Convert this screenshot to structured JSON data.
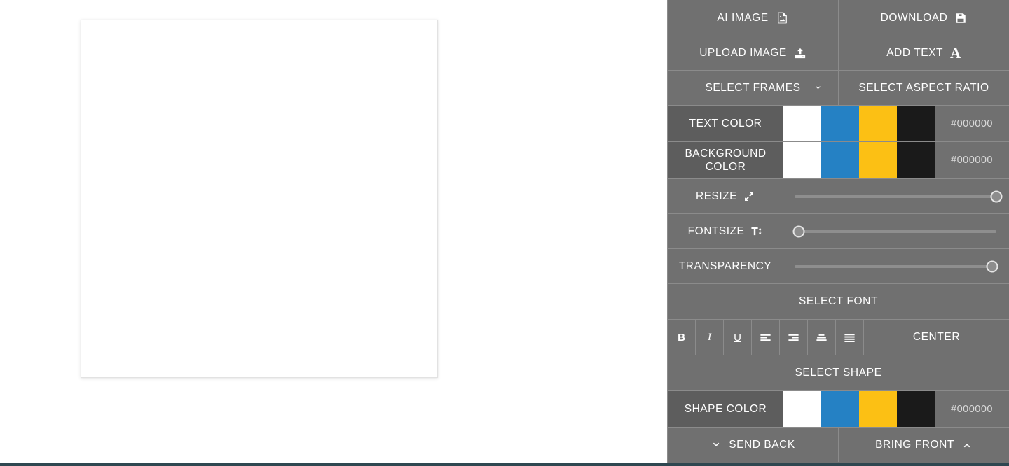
{
  "canvas": {
    "name": "design-canvas",
    "background": "#ffffff"
  },
  "page": {
    "background": "#ffffff",
    "panel_background": "#707070",
    "label_background": "#5d5d5d",
    "accent_bottom_bar": "#2e4750"
  },
  "toolbar": {
    "ai_image": "AI IMAGE",
    "download": "DOWNLOAD",
    "upload_image": "UPLOAD IMAGE",
    "add_text": "ADD TEXT",
    "select_frames": "SELECT FRAMES",
    "select_aspect_ratio": "SELECT ASPECT RATIO",
    "select_font": "SELECT FONT",
    "select_shape": "SELECT SHAPE",
    "send_back": "SEND BACK",
    "bring_front": "BRING FRONT",
    "alignment_value": "CENTER"
  },
  "icons": {
    "ai_image": "image-file-icon",
    "download": "floppy-save-icon",
    "upload": "upload-icon",
    "add_text": "letter-a-icon",
    "frames_chevron": "chevron-down-icon",
    "resize": "diagonal-arrows-icon",
    "fontsize": "text-height-icon",
    "send_back": "chevron-down-icon",
    "bring_front": "chevron-up-icon"
  },
  "color_rows": [
    {
      "label": "TEXT COLOR",
      "hex": "#000000",
      "swatches": [
        "#ffffff",
        "#2581c4",
        "#fcc014",
        "#1a1a1a"
      ]
    },
    {
      "label": "BACKGROUND COLOR",
      "hex": "#000000",
      "swatches": [
        "#ffffff",
        "#2581c4",
        "#fcc014",
        "#1a1a1a"
      ]
    }
  ],
  "shape_color_row": {
    "label": "SHAPE COLOR",
    "hex": "#000000",
    "swatches": [
      "#ffffff",
      "#2581c4",
      "#fcc014",
      "#1a1a1a"
    ]
  },
  "sliders": [
    {
      "label": "RESIZE",
      "value": 100
    },
    {
      "label": "FONTSIZE",
      "value": 2
    },
    {
      "label": "TRANSPARENCY",
      "value": 98
    }
  ],
  "format_buttons": [
    {
      "name": "bold",
      "label": "B"
    },
    {
      "name": "italic",
      "label": "I"
    },
    {
      "name": "underline",
      "label": "U"
    },
    {
      "name": "align-left",
      "label": ""
    },
    {
      "name": "align-right",
      "label": ""
    },
    {
      "name": "align-center",
      "label": ""
    },
    {
      "name": "align-justify",
      "label": ""
    }
  ]
}
